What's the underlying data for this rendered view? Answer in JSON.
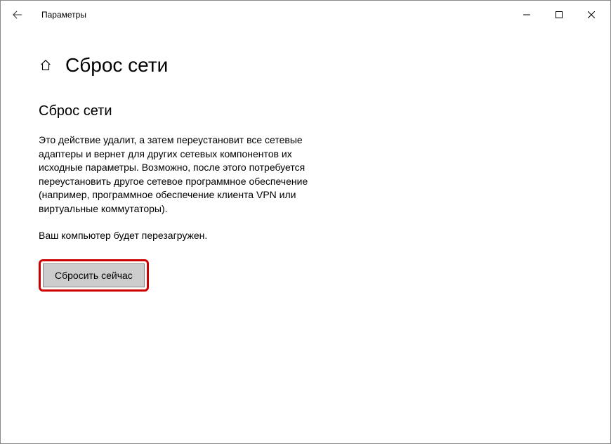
{
  "titlebar": {
    "app_name": "Параметры"
  },
  "header": {
    "title": "Сброс сети"
  },
  "content": {
    "section_title": "Сброс сети",
    "paragraph1": "Это действие удалит, а затем переустановит все сетевые адаптеры и вернет для других сетевых компонентов их исходные параметры. Возможно, после этого потребуется переустановить другое сетевое программное обеспечение (например, программное обеспечение клиента VPN или виртуальные коммутаторы).",
    "paragraph2": "Ваш компьютер будет перезагружен.",
    "reset_button": "Сбросить сейчас"
  }
}
